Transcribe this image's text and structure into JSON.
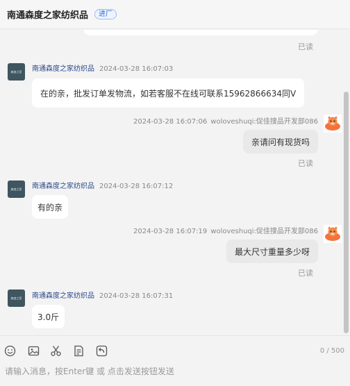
{
  "header": {
    "title": "南通森度之家纺织品",
    "tag": "进厂"
  },
  "shop": {
    "name": "南通森度之家纺织品",
    "avatar_text": "森度之家"
  },
  "user": {
    "name": "woloveshuqi:促佳搜品开发部086"
  },
  "messages": [
    {
      "sender": "shop",
      "time": "2024-03-28 16:07:03",
      "text": "在的亲，批发订单发物流，如若客服不在线可联系15962866634同V"
    },
    {
      "sender": "user",
      "time": "2024-03-28 16:07:06",
      "text": "亲请问有现货吗",
      "status": "已读"
    },
    {
      "sender": "shop",
      "time": "2024-03-28 16:07:12",
      "text": "有的亲"
    },
    {
      "sender": "user",
      "time": "2024-03-28 16:07:19",
      "text": "最大尺寸重量多少呀",
      "status": "已读"
    },
    {
      "sender": "shop",
      "time": "2024-03-28 16:07:31",
      "text": "3.0斤"
    }
  ],
  "top_read": "已读",
  "toolbar": {
    "icons": [
      "emoji-icon",
      "image-icon",
      "scissors-icon",
      "order-icon",
      "quick-reply-icon"
    ]
  },
  "input": {
    "placeholder": "请输入消息，按Enter键 或 点击发送按钮发送",
    "counter": "0 / 500"
  },
  "colors": {
    "background": "#f3f3f3",
    "bubble_shop": "#ffffff",
    "bubble_user": "#e9e9e9",
    "name_link": "#2d4a8a",
    "tag_blue": "#2f6fd6"
  }
}
